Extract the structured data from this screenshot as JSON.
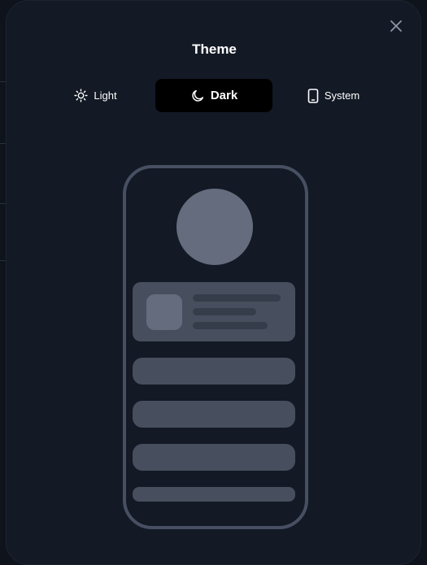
{
  "dialog": {
    "title": "Theme",
    "close_icon": "close-icon"
  },
  "theme_options": [
    {
      "label": "Light",
      "icon": "sun-icon",
      "selected": false
    },
    {
      "label": "Dark",
      "icon": "moon-icon",
      "selected": true
    },
    {
      "label": "System",
      "icon": "smartphone-icon",
      "selected": false
    }
  ],
  "colors": {
    "modal_background": "#131925",
    "selected_segment": "#000000",
    "preview_outline": "#475062",
    "preview_block": "#474f5e",
    "preview_avatar": "#646c7e"
  }
}
